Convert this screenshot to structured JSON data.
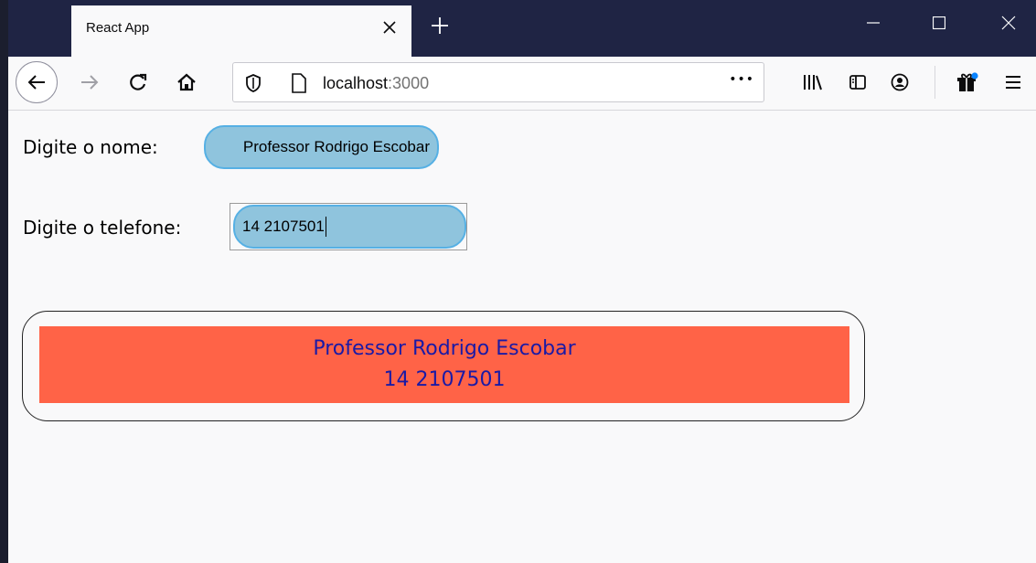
{
  "browser": {
    "tab_title": "React App",
    "url_host": "localhost",
    "url_port": ":3000",
    "overflow_label": "•••",
    "icons": [
      "close-icon",
      "plus-icon",
      "minimize-icon",
      "maximize-icon",
      "window-close-icon",
      "back-icon",
      "forward-icon",
      "reload-icon",
      "home-icon",
      "shield-icon",
      "page-icon",
      "library-icon",
      "sidebar-icon",
      "account-icon",
      "gift-icon",
      "menu-icon"
    ]
  },
  "form": {
    "name_label": "Digite o nome:",
    "name_value": "Professor Rodrigo Escobar",
    "phone_label": "Digite o telefone:",
    "phone_value": "14 2107501"
  },
  "card": {
    "name": "Professor Rodrigo Escobar",
    "phone": "14 2107501"
  },
  "colors": {
    "titlebar": "#1f2444",
    "input_fill": "#8fc4dd",
    "input_border": "#56b0e4",
    "card_fill": "#ff6347",
    "card_text": "#1a1aa6"
  }
}
